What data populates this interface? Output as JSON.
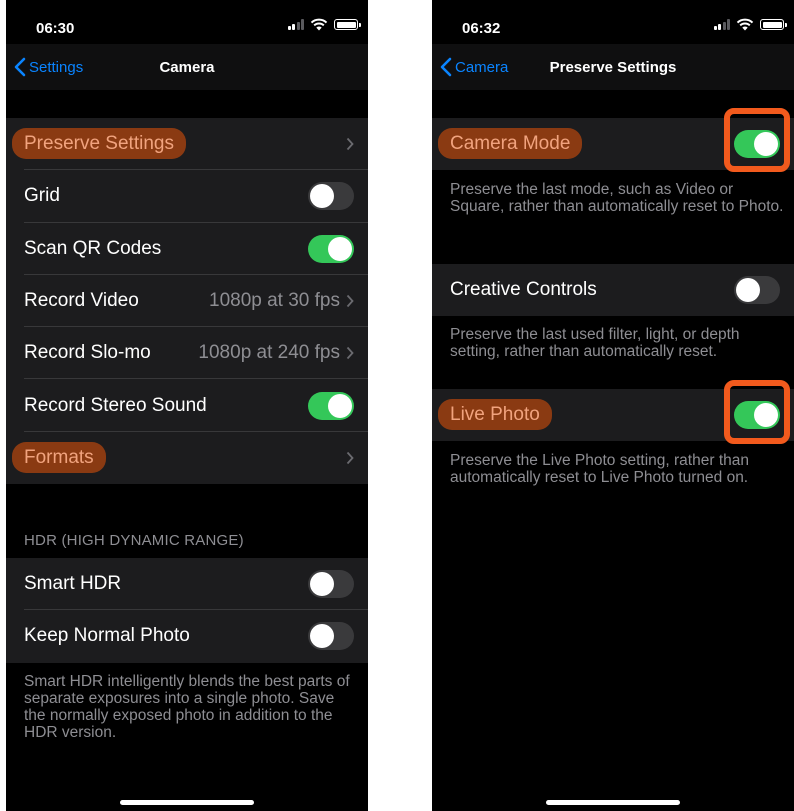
{
  "left": {
    "status": {
      "time": "06:30"
    },
    "nav": {
      "back_label": "Settings",
      "title": "Camera"
    },
    "rows": [
      {
        "label": "Preserve Settings",
        "value": ""
      },
      {
        "label": "Grid",
        "toggle": "off"
      },
      {
        "label": "Scan QR Codes",
        "toggle": "on"
      },
      {
        "label": "Record Video",
        "value": "1080p at 30 fps"
      },
      {
        "label": "Record Slo-mo",
        "value": "1080p at 240 fps"
      },
      {
        "label": "Record Stereo Sound",
        "toggle": "on"
      },
      {
        "label": "Formats",
        "value": ""
      }
    ],
    "hdr": {
      "header": "HDR (HIGH DYNAMIC RANGE)",
      "rows": [
        {
          "label": "Smart HDR",
          "toggle": "off"
        },
        {
          "label": "Keep Normal Photo",
          "toggle": "off"
        }
      ],
      "footer": "Smart HDR intelligently blends the best parts of separate exposures into a single photo. Save the normally exposed photo in addition to the HDR version."
    }
  },
  "right": {
    "status": {
      "time": "06:32"
    },
    "nav": {
      "back_label": "Camera",
      "title": "Preserve Settings"
    },
    "sections": [
      {
        "label": "Camera Mode",
        "toggle": "on",
        "footer": "Preserve the last mode, such as Video or Square, rather than automatically reset to Photo."
      },
      {
        "label": "Creative Controls",
        "toggle": "off",
        "footer": "Preserve the last used filter, light, or depth setting, rather than automatically reset."
      },
      {
        "label": "Live Photo",
        "toggle": "on",
        "footer": "Preserve the Live Photo setting, rather than automatically reset to Live Photo turned on."
      }
    ]
  },
  "colors": {
    "background": "#000000",
    "cell": "#1c1c1e",
    "accent_blue": "#0a84ff",
    "toggle_on": "#34c759",
    "annotation_orange": "#f25a1d",
    "annotation_highlight": "#8a3a12"
  },
  "icons": [
    "signal-icon",
    "wifi-icon",
    "battery-icon",
    "back-chevron-icon",
    "chevron-right-icon"
  ]
}
